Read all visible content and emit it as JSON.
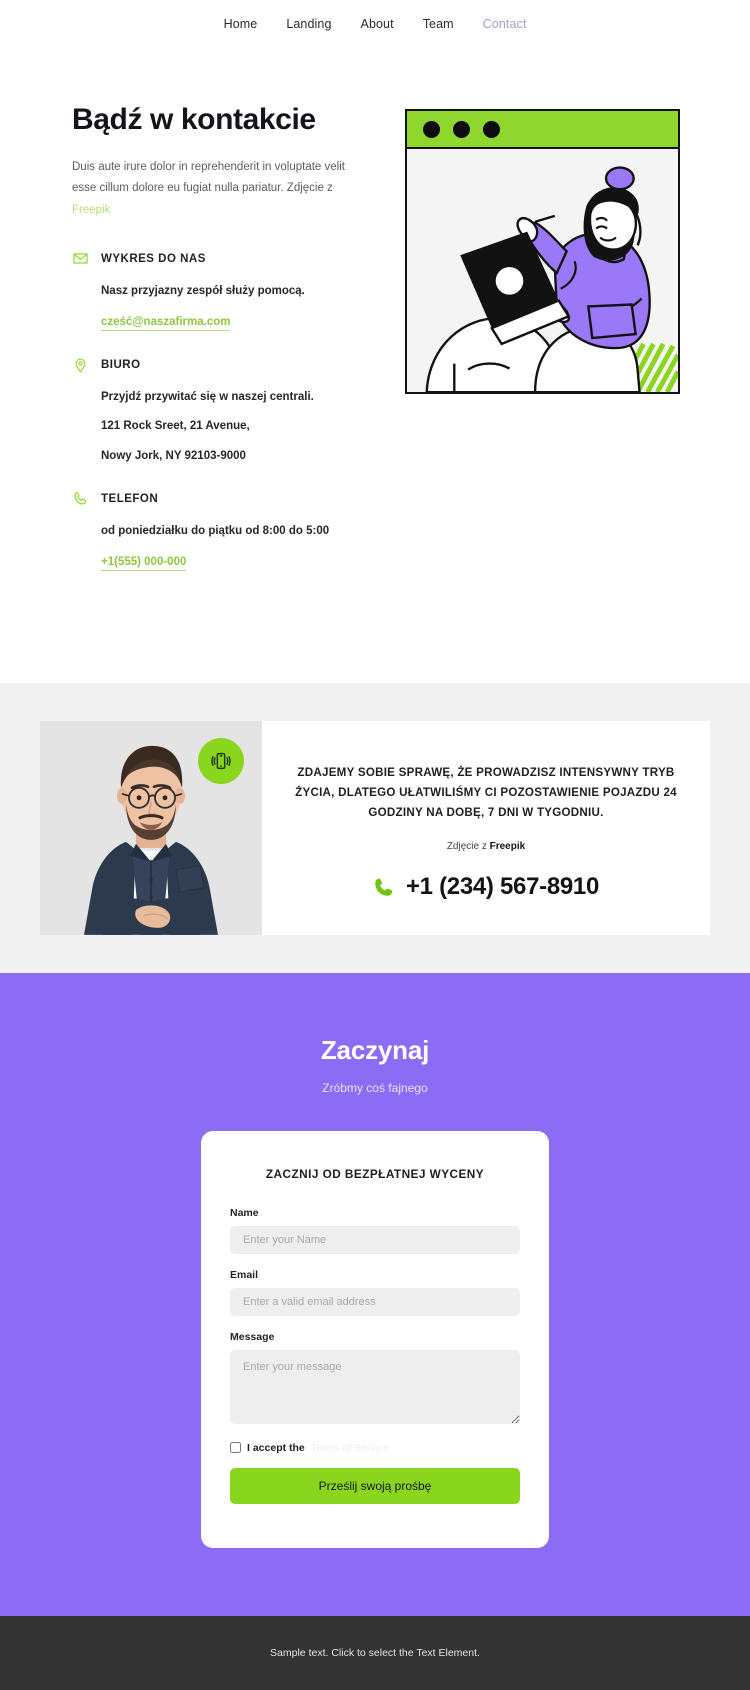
{
  "nav": {
    "items": [
      {
        "label": "Home",
        "active": false
      },
      {
        "label": "Landing",
        "active": false
      },
      {
        "label": "About",
        "active": false
      },
      {
        "label": "Team",
        "active": false
      },
      {
        "label": "Contact",
        "active": true
      }
    ]
  },
  "hero": {
    "title": "Bądź w kontakcie",
    "lede_text": "Duis aute irure dolor in reprehenderit in voluptate velit esse cillum dolore eu fugiat nulla pariatur. Zdjęcie z ",
    "lede_link": "Freepik",
    "blocks": [
      {
        "icon": "envelope-icon",
        "title": "WYKRES DO NAS",
        "lines": [
          "Nasz przyjazny zespół służy pomocą."
        ],
        "link": "cześć@naszafirma.com"
      },
      {
        "icon": "map-pin-icon",
        "title": "BIURO",
        "lines": [
          "Przyjdź przywitać się w naszej centrali.",
          "121 Rock Sreet, 21 Avenue,",
          "Nowy Jork, NY 92103-9000"
        ],
        "link": null
      },
      {
        "icon": "phone-icon",
        "title": "TELEFON",
        "lines": [
          "od poniedziałku do piątku od 8:00 do 5:00"
        ],
        "link": "+1(555) 000-000"
      }
    ],
    "illustration": {
      "alt": "person-with-laptop-illustration",
      "window_dots": 3
    }
  },
  "cta": {
    "photo_alt": "man-with-glasses-photo",
    "badge_icon": "vibrating-mobile-icon",
    "headline": "ZDAJEMY SOBIE SPRAWĘ, ŻE PROWADZISZ INTENSYWNY TRYB ŻYCIA, DLATEGO UŁATWILIŚMY CI POZOSTAWIENIE POJAZDU 24 GODZINY NA DOBĘ, 7 DNI W TYGODNIU.",
    "credit_prefix": "Zdjęcie z ",
    "credit_source": "Freepik",
    "phone": "+1 (234) 567-8910"
  },
  "form_section": {
    "title": "Zaczynaj",
    "subtitle": "Zróbmy coś fajnego",
    "card_title": "ZACZNIJ OD BEZPŁATNEJ WYCENY",
    "fields": [
      {
        "label": "Name",
        "placeholder": "Enter your Name",
        "value": "",
        "type": "text"
      },
      {
        "label": "Email",
        "placeholder": "Enter a valid email address",
        "value": "",
        "type": "email"
      }
    ],
    "message_label": "Message",
    "message_placeholder": "Enter your message",
    "message_value": "",
    "accept_label": "I accept the",
    "accept_link": "Terms of Service",
    "accept_checked": false,
    "submit_label": "Prześlij swoją prośbę"
  },
  "footer": {
    "text": "Sample text. Click to select the Text Element."
  },
  "colors": {
    "green": "#8ad61f",
    "purple": "#8c6cf5",
    "gray_section": "#f1f1f1",
    "footer": "#333333",
    "nav_muted": "#a99fc4"
  }
}
